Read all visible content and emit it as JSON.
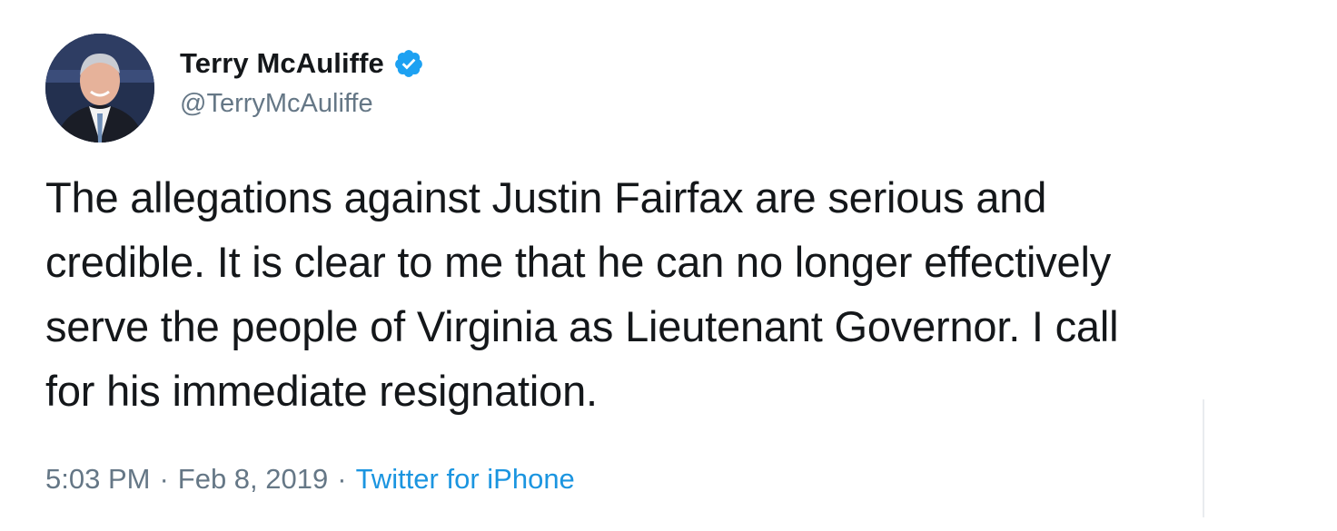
{
  "author": {
    "name": "Terry McAuliffe",
    "handle": "@TerryMcAuliffe",
    "verified": true,
    "avatar_icon": "profile-photo"
  },
  "tweet": {
    "lines": [
      "The allegations against Justin Fairfax are serious and",
      "credible. It is clear to me that he can no longer effectively",
      "serve the people of Virginia as Lieutenant Governor. I call",
      "for his immediate resignation."
    ]
  },
  "meta": {
    "time": "5:03 PM",
    "separator": "·",
    "date": "Feb 8, 2019",
    "source": "Twitter for iPhone"
  },
  "colors": {
    "text": "#14171a",
    "secondary": "#657786",
    "link": "#1b95e0",
    "verified_badge": "#1da1f2"
  }
}
